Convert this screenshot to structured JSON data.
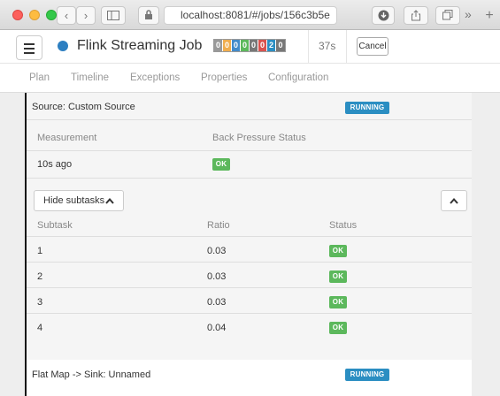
{
  "browser": {
    "url": "localhost:8081/#/jobs/156c3b5e",
    "back_glyph": "‹",
    "forward_glyph": "›",
    "more_glyph": "»",
    "new_tab_glyph": "+"
  },
  "header": {
    "job_name": "Flink Streaming Job",
    "task_counts": [
      "0",
      "0",
      "0",
      "0",
      "0",
      "0",
      "2",
      "0"
    ],
    "task_colors": [
      "#999999",
      "#f0ad4e",
      "#428bca",
      "#5cb85c",
      "#777777",
      "#d9534f",
      "#2b8ec2",
      "#777777"
    ],
    "duration": "37s",
    "cancel_label": "Cancel",
    "status_color": "#2d7fc1"
  },
  "tabs": [
    "Plan",
    "Timeline",
    "Exceptions",
    "Properties",
    "Configuration"
  ],
  "source": {
    "name": "Source: Custom Source",
    "status": "RUNNING",
    "measurement_header": "Measurement",
    "backpressure_header": "Back Pressure Status",
    "measurement": "10s ago",
    "backpressure": "OK",
    "hide_subtasks_label": "Hide subtasks",
    "subtask_header": "Subtask",
    "ratio_header": "Ratio",
    "status_header": "Status",
    "subtasks": [
      {
        "id": "1",
        "ratio": "0.03",
        "status": "OK"
      },
      {
        "id": "2",
        "ratio": "0.03",
        "status": "OK"
      },
      {
        "id": "3",
        "ratio": "0.03",
        "status": "OK"
      },
      {
        "id": "4",
        "ratio": "0.04",
        "status": "OK"
      }
    ]
  },
  "next_vertex": {
    "name": "Flat Map -> Sink: Unnamed",
    "status": "RUNNING"
  },
  "colors": {
    "running": "#2b8ec2",
    "ok": "#5cb85c"
  }
}
